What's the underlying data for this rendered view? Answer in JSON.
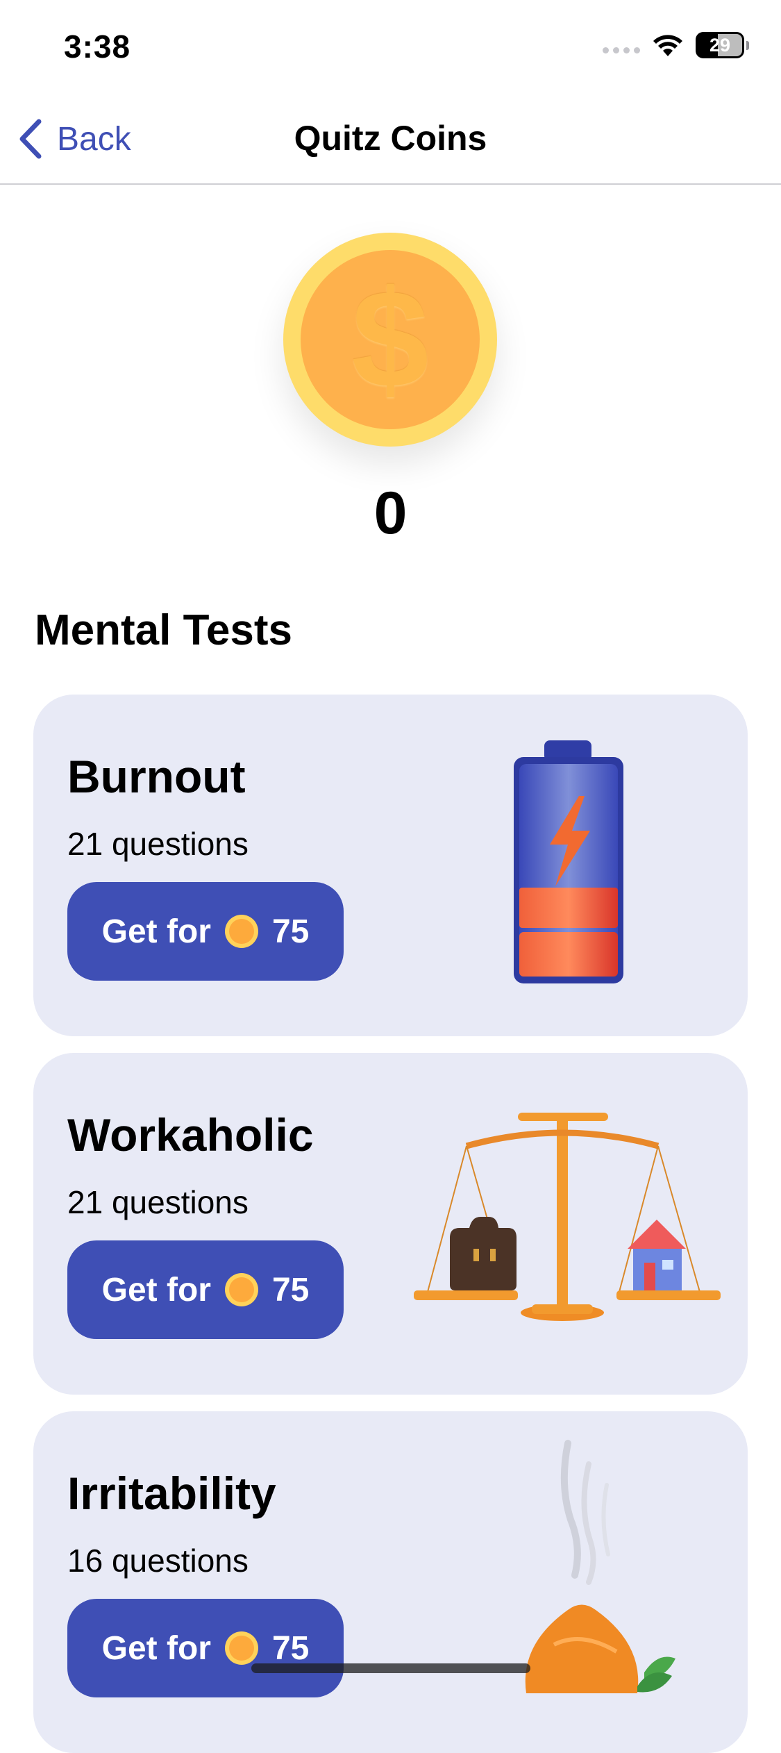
{
  "status_bar": {
    "time": "3:38",
    "battery_level": "29",
    "icons": [
      "signal-icon",
      "wifi-icon",
      "battery-icon"
    ]
  },
  "nav": {
    "back_label": "Back",
    "title": "Quitz Coins",
    "accent_color": "#3f4fb5"
  },
  "wallet": {
    "coin_icon": "dollar-coin-icon",
    "coin_symbol": "$",
    "balance": "0"
  },
  "section": {
    "title": "Mental Tests"
  },
  "tests": [
    {
      "title": "Burnout",
      "questions": "21 questions",
      "button_label": "Get for",
      "price": "75",
      "image": "battery-illustration"
    },
    {
      "title": "Workaholic",
      "questions": "21 questions",
      "button_label": "Get for",
      "price": "75",
      "image": "scales-work-home-illustration"
    },
    {
      "title": "Irritability",
      "questions": "16 questions",
      "button_label": "Get for",
      "price": "75",
      "image": "diffuser-illustration"
    }
  ],
  "colors": {
    "card_background": "#e8eaf6",
    "button": "#3f4fb5",
    "coin_outer": "#fedc6a",
    "coin_inner": "#feb14c"
  }
}
